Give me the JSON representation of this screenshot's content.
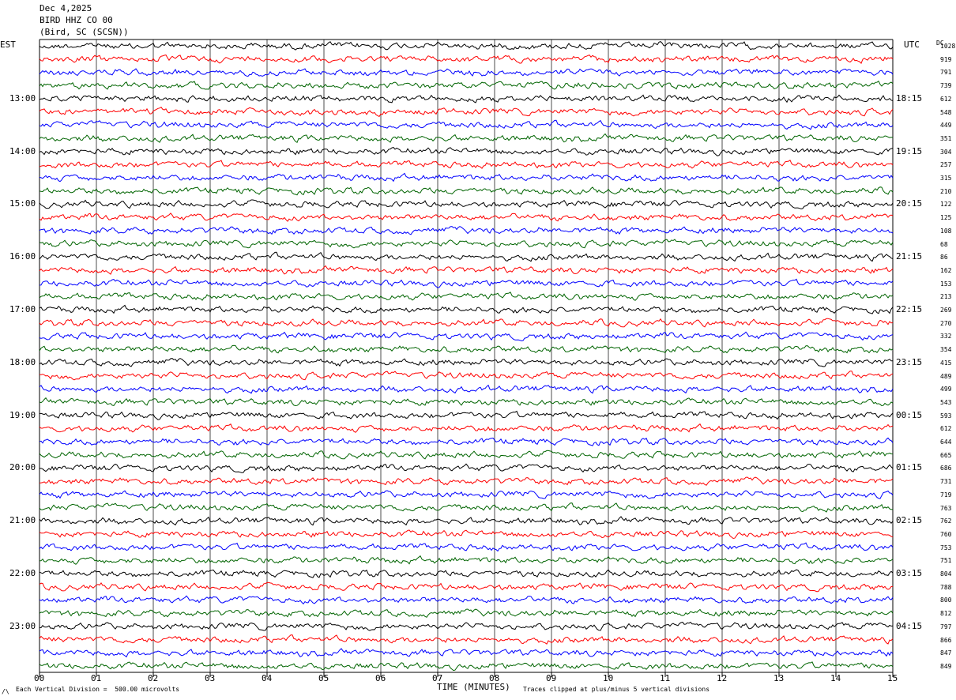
{
  "chart_data": {
    "type": "line",
    "header": {
      "date": "Dec 4,2025",
      "station": "BIRD HHZ CO 00",
      "location": "(Bird, SC (SCSN))"
    },
    "left_axis_label": "EST",
    "right_axis_label": "UTC",
    "dc_label": "DC",
    "xlabel": "TIME (MINUTES)",
    "x_ticks": [
      "00",
      "01",
      "02",
      "03",
      "04",
      "05",
      "06",
      "07",
      "08",
      "09",
      "10",
      "11",
      "12",
      "13",
      "14",
      "15"
    ],
    "xlim": [
      0,
      15
    ],
    "left_hour_labels": [
      "13:00",
      "14:00",
      "15:00",
      "16:00",
      "17:00",
      "18:00",
      "19:00",
      "20:00",
      "21:00",
      "22:00",
      "23:00"
    ],
    "right_hour_labels": [
      "18:15",
      "19:15",
      "20:15",
      "21:15",
      "22:15",
      "23:15",
      "00:15",
      "01:15",
      "02:15",
      "03:15",
      "04:15"
    ],
    "trace_colors": [
      "#000000",
      "#ff0000",
      "#0000ff",
      "#006400"
    ],
    "dc_offsets": [
      1028,
      919,
      791,
      739,
      612,
      548,
      449,
      351,
      304,
      257,
      315,
      210,
      122,
      125,
      108,
      68,
      86,
      162,
      153,
      213,
      269,
      270,
      332,
      354,
      415,
      489,
      499,
      543,
      593,
      612,
      644,
      665,
      686,
      731,
      719,
      763,
      762,
      760,
      753,
      751,
      804,
      788,
      800,
      812,
      797,
      866,
      847,
      849
    ],
    "footer_left": "Each Vertical Division =  500.00 microvolts",
    "footer_right": "Traces clipped at plus/minus 5 vertical divisions",
    "corner_mark": "/\\"
  }
}
